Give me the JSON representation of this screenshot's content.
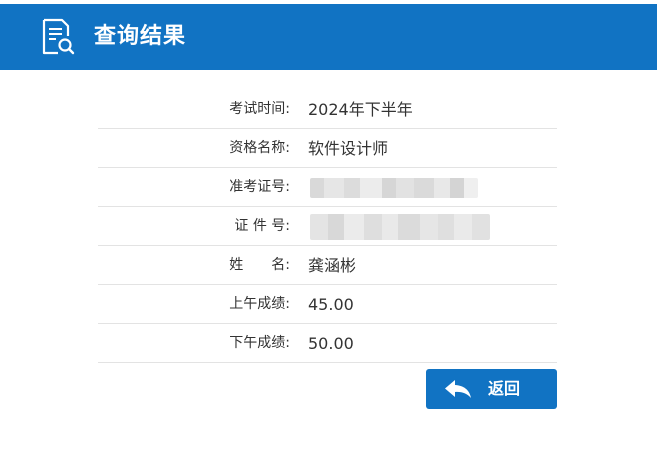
{
  "header": {
    "title": "查询结果",
    "icon": "document-search-icon"
  },
  "results": [
    {
      "label": "考试时间:",
      "value": "2024年下半年"
    },
    {
      "label": "资格名称:",
      "value": "软件设计师"
    },
    {
      "label": "准考证号:",
      "value": "",
      "redacted": true
    },
    {
      "label": "证 件 号:",
      "value": "",
      "redacted": true
    },
    {
      "label": "姓　　名:",
      "value": "龚涵彬"
    },
    {
      "label": "上午成绩:",
      "value": "45.00"
    },
    {
      "label": "下午成绩:",
      "value": "50.00"
    }
  ],
  "back_button": {
    "label": "返回",
    "icon": "return-arrow-icon"
  },
  "colors": {
    "brand_blue": "#1173c3",
    "divider": "#e3e3e3",
    "text": "#333333"
  }
}
